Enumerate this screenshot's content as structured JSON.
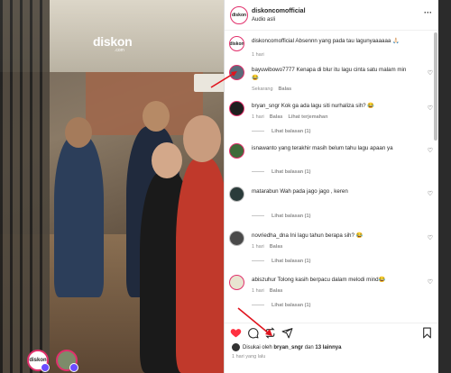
{
  "video": {
    "logo_brand": "diskon",
    "logo_sub": ".com",
    "avatar1_label": "diskon",
    "avatar2_label": ""
  },
  "post": {
    "username": "diskoncomofficial",
    "audio": "Audio asli",
    "more": "···"
  },
  "comments": [
    {
      "user": "diskoncomofficial",
      "text": "Absennn yang pada tau lagunyaaaaaa 🙏🏻",
      "time": "1 hari",
      "actions": [],
      "replies": "",
      "heart": false
    },
    {
      "user": "bayuwibowo7777",
      "text": "Kenapa di blur itu lagu cinta satu malam min 😂",
      "time": "Sekarang",
      "actions": [
        "Balas"
      ],
      "replies": "",
      "heart": true
    },
    {
      "user": "bryan_sngr",
      "text": "Kok ga ada lagu siti nurhaliza sih? 😂",
      "time": "1 hari",
      "actions": [
        "Balas",
        "Lihat terjemahan"
      ],
      "replies": "Lihat balasan (1)",
      "heart": true
    },
    {
      "user": "isnawanto",
      "text": "yang terakhir masih belum tahu lagu apaan ya",
      "time": "",
      "actions": [],
      "replies": "Lihat balasan (1)",
      "heart": true
    },
    {
      "user": "matarabun",
      "text": "Wah pada jago jago , keren",
      "time": "",
      "actions": [],
      "replies": "Lihat balasan (1)",
      "heart": true
    },
    {
      "user": "novriedha_dna",
      "text": "Ini lagu tahun berapa sih? 😂",
      "time": "1 hari",
      "actions": [
        "Balas"
      ],
      "replies": "Lihat balasan (1)",
      "heart": true
    },
    {
      "user": "abiszuhur",
      "text": "Tolong kasih berpacu dalam melodi mind😂",
      "time": "1 hari",
      "actions": [
        "Balas"
      ],
      "replies": "Lihat balasan (1)",
      "heart": true
    }
  ],
  "actions": {
    "like_icon": "heart-filled-icon",
    "comment_icon": "comment-icon",
    "repost_icon": "repost-icon",
    "share_icon": "send-icon",
    "save_icon": "bookmark-icon"
  },
  "likes": {
    "prefix": "Disukai oleh",
    "user": "bryan_sngr",
    "mid": "dan",
    "rest": "13 lainnya"
  },
  "posted_time": "1 hari yang lalu",
  "colors": {
    "like_red": "#ff3040",
    "ring": "#e1306c",
    "annotation_arrow": "#e0141e"
  }
}
